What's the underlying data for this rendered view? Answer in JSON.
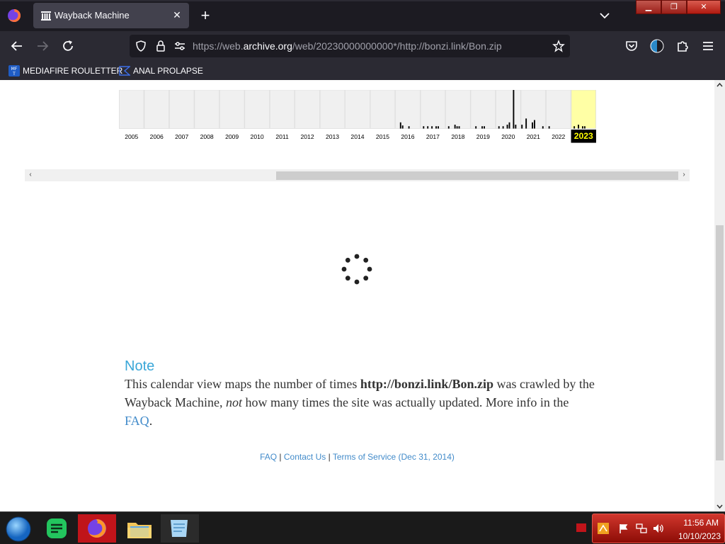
{
  "browser": {
    "tab_title": "Wayback Machine",
    "url_prefix": "https://web.",
    "url_domain": "archive.org",
    "url_rest": "/web/20230000000000*/http://bonzi.link/Bon.zip"
  },
  "bookmarks": [
    {
      "label": "MEDIAFIRE ROULETTER",
      "icon": "mediafire-icon"
    },
    {
      "label": "ANAL PROLAPSE",
      "icon": "bookmark-site-icon"
    }
  ],
  "chart_data": {
    "type": "bar",
    "title": "",
    "categories": [
      "2005",
      "2006",
      "2007",
      "2008",
      "2009",
      "2010",
      "2011",
      "2012",
      "2013",
      "2014",
      "2015",
      "2016",
      "2017",
      "2018",
      "2019",
      "2020",
      "2021",
      "2022",
      "2023"
    ],
    "selected_year": "2023",
    "series": [
      {
        "monthly_heights_fraction": [
          [
            0,
            0,
            0,
            0,
            0,
            0,
            0,
            0,
            0,
            0,
            0,
            0
          ],
          [
            0,
            0,
            0,
            0,
            0,
            0,
            0,
            0,
            0,
            0,
            0,
            0
          ],
          [
            0,
            0,
            0,
            0,
            0,
            0,
            0,
            0,
            0,
            0,
            0,
            0
          ],
          [
            0,
            0,
            0,
            0,
            0,
            0,
            0,
            0,
            0,
            0,
            0,
            0
          ],
          [
            0,
            0,
            0,
            0,
            0,
            0,
            0,
            0,
            0,
            0,
            0,
            0
          ],
          [
            0,
            0,
            0,
            0,
            0,
            0,
            0,
            0,
            0,
            0,
            0,
            0
          ],
          [
            0,
            0,
            0,
            0,
            0,
            0,
            0,
            0,
            0,
            0,
            0,
            0
          ],
          [
            0,
            0,
            0,
            0,
            0,
            0,
            0,
            0,
            0,
            0,
            0,
            0
          ],
          [
            0,
            0,
            0,
            0,
            0,
            0,
            0,
            0,
            0,
            0,
            0,
            0
          ],
          [
            0,
            0,
            0,
            0,
            0,
            0,
            0,
            0,
            0,
            0,
            0,
            0
          ],
          [
            0,
            0,
            0,
            0,
            0,
            0,
            0,
            0,
            0,
            0,
            0,
            0
          ],
          [
            0,
            0,
            0.16,
            0.08,
            0,
            0,
            0.06,
            0,
            0,
            0,
            0,
            0
          ],
          [
            0,
            0.06,
            0,
            0.06,
            0,
            0.06,
            0,
            0.06,
            0.06,
            0,
            0,
            0
          ],
          [
            0,
            0.06,
            0,
            0,
            0.1,
            0.06,
            0.06,
            0,
            0,
            0,
            0,
            0
          ],
          [
            0,
            0,
            0.06,
            0,
            0,
            0.06,
            0.06,
            0,
            0,
            0,
            0,
            0
          ],
          [
            0,
            0.06,
            0,
            0.06,
            0,
            0.1,
            0.16,
            0,
            1.0,
            0.1,
            0,
            0
          ],
          [
            0.1,
            0,
            0.26,
            0,
            0,
            0.16,
            0.22,
            0,
            0,
            0,
            0.06,
            0
          ],
          [
            0,
            0.06,
            0,
            0,
            0,
            0,
            0,
            0,
            0,
            0,
            0,
            0
          ],
          [
            0,
            0.06,
            0,
            0.1,
            0,
            0.06,
            0.06,
            0,
            0,
            0,
            0,
            0
          ]
        ]
      }
    ]
  },
  "loading": true,
  "note": {
    "title": "Note",
    "text_1": "This calendar view maps the number of times ",
    "url": "http://bonzi.link/Bon.zip",
    "text_2": " was crawled by the Wayback Machine, ",
    "emph": "not",
    "text_3": " how many times the site was actually updated. More info in the ",
    "faq_link": "FAQ",
    "text_4": "."
  },
  "footer": {
    "faq": "FAQ",
    "contact": "Contact Us",
    "terms": "Terms of Service (Dec 31, 2014)",
    "sep": " | "
  },
  "taskbar": {
    "time": "11:56 AM",
    "date": "10/10/2023"
  },
  "colors": {
    "accent_note": "#3aa7d8",
    "link": "#428bca",
    "selected_year_bg": "#ffffa5"
  }
}
